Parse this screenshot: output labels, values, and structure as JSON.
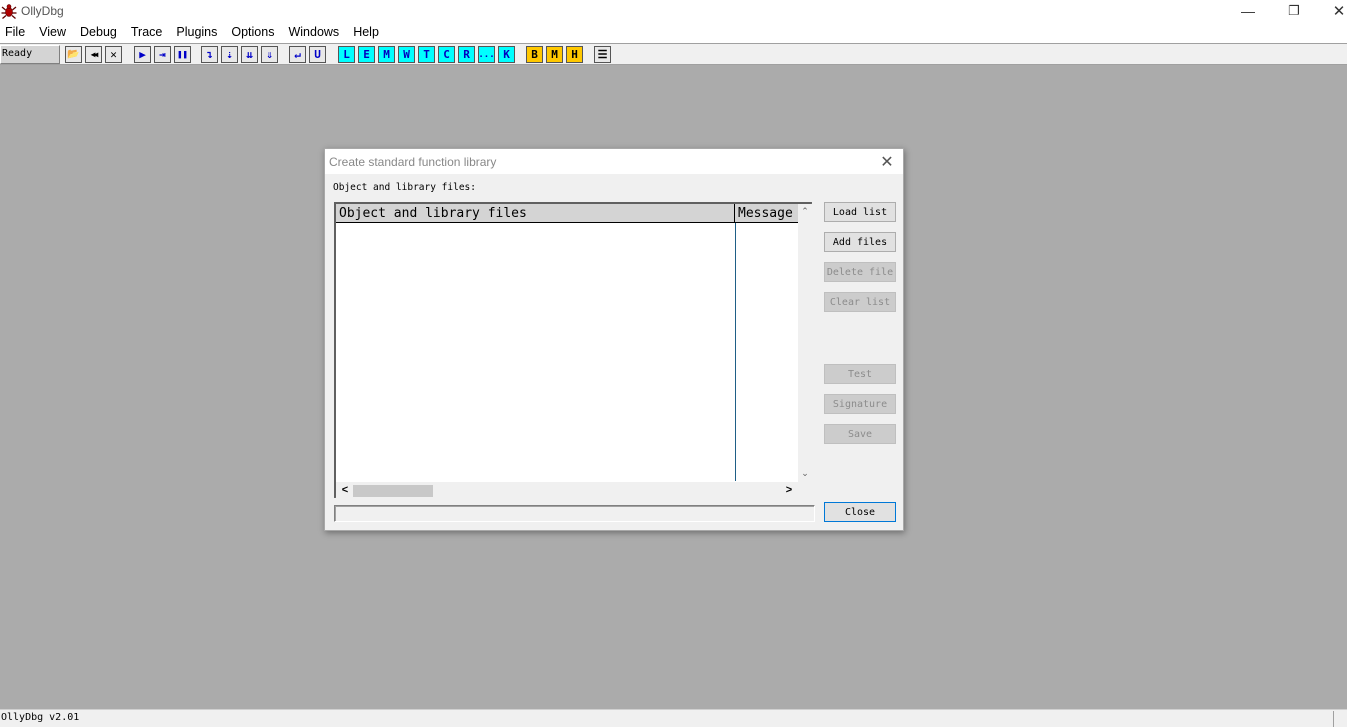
{
  "app": {
    "title": "OllyDbg",
    "window_controls": {
      "minimize": "—",
      "maximize": "❐",
      "close": "✕"
    }
  },
  "menu": {
    "items": [
      "File",
      "View",
      "Debug",
      "Trace",
      "Plugins",
      "Options",
      "Windows",
      "Help"
    ]
  },
  "toolbar": {
    "status": "Ready",
    "buttons": [
      {
        "name": "open-icon",
        "glyph": "📂",
        "style": "gray"
      },
      {
        "name": "restart-icon",
        "glyph": "◀◀",
        "style": "gray"
      },
      {
        "name": "close-program-icon",
        "glyph": "✕",
        "style": "gray"
      },
      {
        "name": "run-icon",
        "glyph": "▶",
        "style": "blue"
      },
      {
        "name": "run-thread-icon",
        "glyph": "⇥",
        "style": "blue"
      },
      {
        "name": "pause-icon",
        "glyph": "❚❚",
        "style": "blue"
      },
      {
        "name": "step-into-icon",
        "glyph": "↴",
        "style": "blue"
      },
      {
        "name": "step-over-icon",
        "glyph": "⇣",
        "style": "blue"
      },
      {
        "name": "trace-into-icon",
        "glyph": "⇊",
        "style": "blue"
      },
      {
        "name": "trace-over-icon",
        "glyph": "⇓",
        "style": "blue"
      },
      {
        "name": "execute-till-return-icon",
        "glyph": "↵",
        "style": "blue"
      },
      {
        "name": "execute-till-user-code-icon",
        "glyph": "U",
        "style": "blue"
      },
      {
        "name": "log-window-icon",
        "glyph": "L",
        "style": "cyan"
      },
      {
        "name": "modules-window-icon",
        "glyph": "E",
        "style": "cyan"
      },
      {
        "name": "memory-window-icon",
        "glyph": "M",
        "style": "cyan"
      },
      {
        "name": "windows-window-icon",
        "glyph": "W",
        "style": "cyan"
      },
      {
        "name": "threads-window-icon",
        "glyph": "T",
        "style": "cyan"
      },
      {
        "name": "cpu-window-icon",
        "glyph": "C",
        "style": "cyan"
      },
      {
        "name": "references-window-icon",
        "glyph": "R",
        "style": "cyan"
      },
      {
        "name": "run-trace-icon",
        "glyph": "...",
        "style": "cyan"
      },
      {
        "name": "call-stack-icon",
        "glyph": "K",
        "style": "cyan"
      },
      {
        "name": "breakpoints-icon",
        "glyph": "B",
        "style": "yellow"
      },
      {
        "name": "memory-breakpoints-icon",
        "glyph": "M",
        "style": "yellow"
      },
      {
        "name": "hardware-breakpoints-icon",
        "glyph": "H",
        "style": "yellow"
      },
      {
        "name": "list-icon",
        "glyph": "☰",
        "style": "gray"
      }
    ]
  },
  "dialog": {
    "title": "Create standard function library",
    "close_glyph": "✕",
    "list_label": "Object and library files:",
    "columns": [
      "Object and library files",
      "Message"
    ],
    "rows": [],
    "buttons": {
      "load_list": "Load list",
      "add_files": "Add files",
      "delete_file": "Delete file",
      "clear_list": "Clear list",
      "test": "Test",
      "signature": "Signature",
      "save": "Save",
      "close": "Close"
    },
    "scroll_glyphs": {
      "up": "⌃",
      "down": "⌄",
      "left": "<",
      "right": ">"
    }
  },
  "statusbar": {
    "text": "OllyDbg v2.01"
  }
}
